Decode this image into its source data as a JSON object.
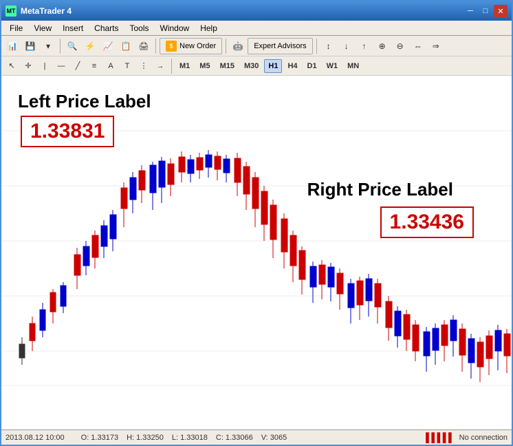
{
  "titleBar": {
    "title": "MetaTrader 4",
    "minimize": "─",
    "maximize": "□",
    "close": "✕"
  },
  "menuBar": {
    "items": [
      "File",
      "View",
      "Insert",
      "Charts",
      "Tools",
      "Window",
      "Help"
    ]
  },
  "toolbar1": {
    "newOrderLabel": "New Order",
    "expertAdvisorsLabel": "Expert Advisors"
  },
  "toolbar2": {
    "timeframes": [
      "M1",
      "M5",
      "M15",
      "M30",
      "H1",
      "H4",
      "D1",
      "W1",
      "MN"
    ]
  },
  "chart": {
    "leftPriceLabel": "Left Price Label",
    "leftPriceValue": "1.33831",
    "rightPriceLabel": "Right Price Label",
    "rightPriceValue": "1.33436"
  },
  "statusBar": {
    "datetime": "2013.08.12 10:00",
    "open": "O: 1.33173",
    "high": "H: 1.33250",
    "low": "L: 1.33018",
    "close": "C: 1.33066",
    "volume": "V: 3065",
    "noConnection": "No connection"
  }
}
